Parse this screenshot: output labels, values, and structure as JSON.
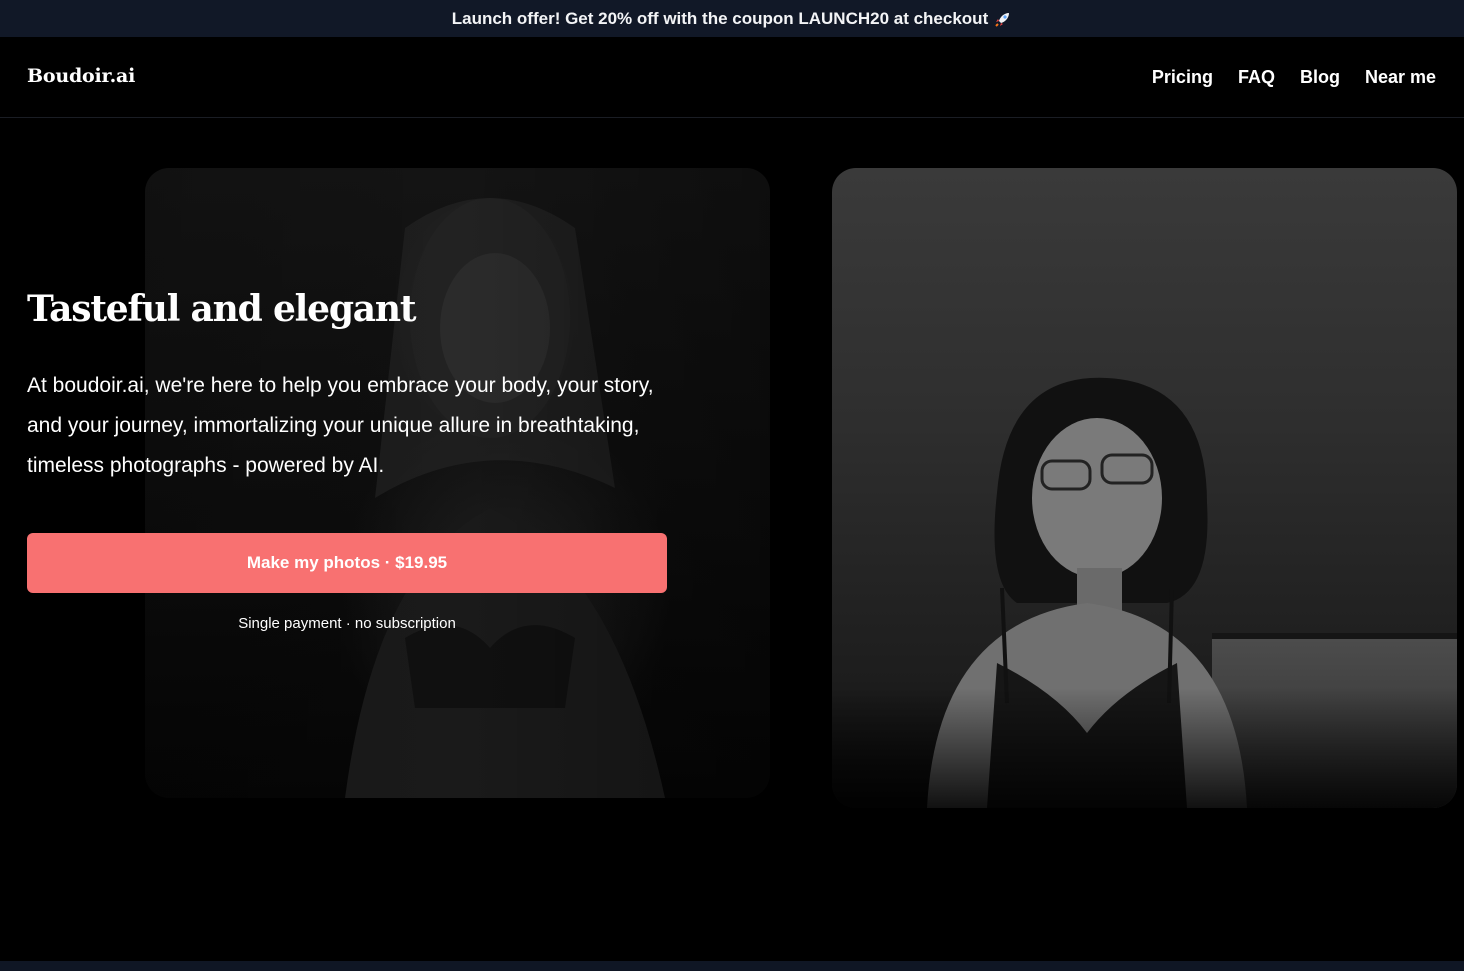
{
  "announcement": {
    "text": "Launch offer! Get 20% off with the coupon LAUNCH20 at checkout",
    "icon": "rocket-icon"
  },
  "nav": {
    "logo": "Boudoir.ai",
    "links": [
      "Pricing",
      "FAQ",
      "Blog",
      "Near me"
    ]
  },
  "hero": {
    "title": "Tasteful and elegant",
    "description": "At boudoir.ai, we're here to help you embrace your body, your story, and your journey, immortalizing your unique allure in breathtaking, timeless photographs - powered by AI.",
    "cta_label": "Make my photos · $19.95",
    "cta_note": "Single payment · no subscription"
  },
  "colors": {
    "accent": "#f87171",
    "announce_bg": "#111827",
    "page_bg": "#000000"
  }
}
